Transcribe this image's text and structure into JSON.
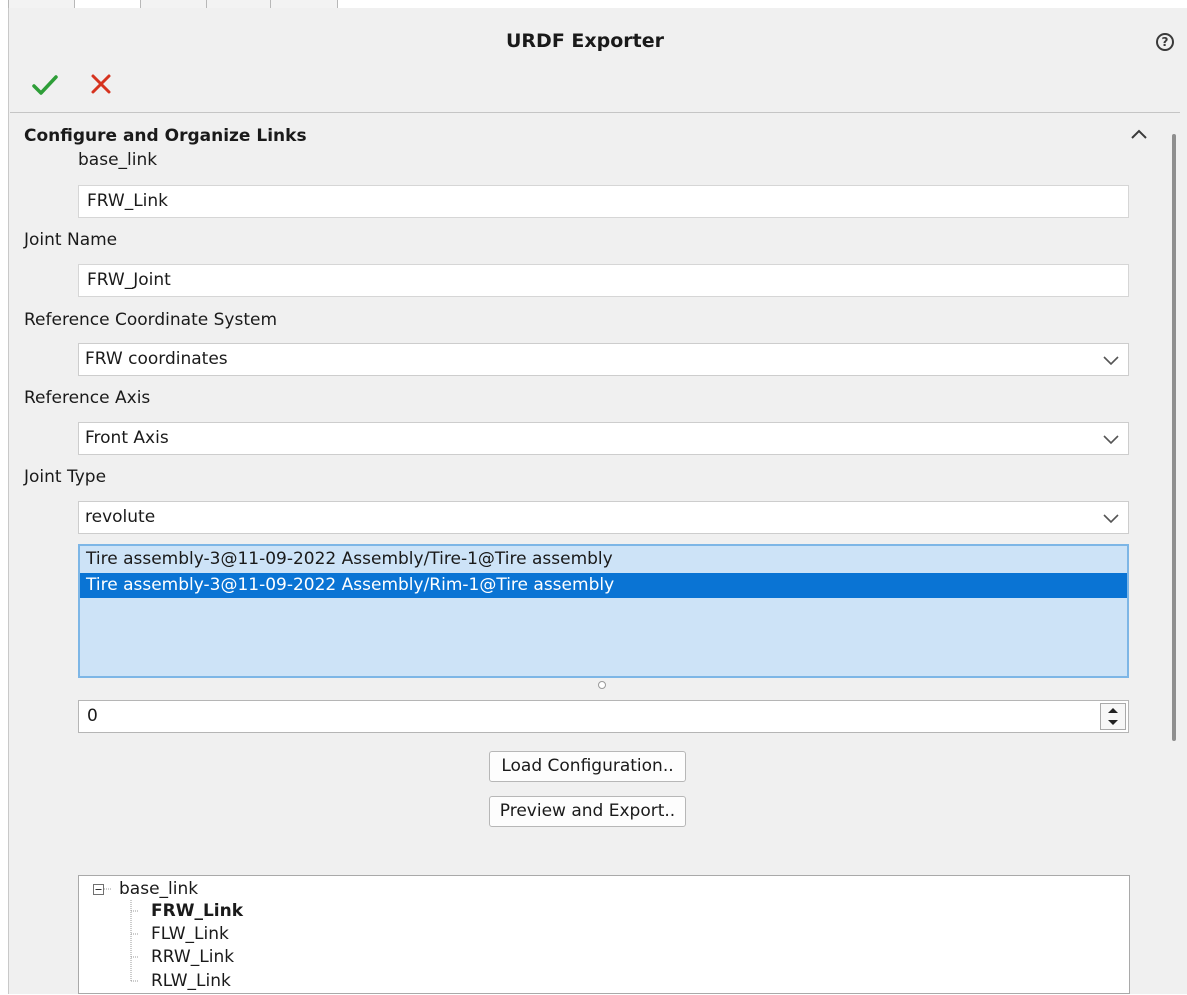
{
  "window": {
    "title": "URDF Exporter"
  },
  "header": {
    "help_icon": "help-icon",
    "ok_icon": "checkmark-icon",
    "cancel_icon": "close-icon",
    "colors": {
      "ok": "#2e9e38",
      "cancel": "#d6331f"
    }
  },
  "section": {
    "title": "Configure and Organize Links",
    "collapse_icon": "chevron-up-icon"
  },
  "form": {
    "link_label": "base_link",
    "link_name_value": "FRW_Link",
    "joint_name_label": "Joint Name",
    "joint_name_value": "FRW_Joint",
    "ref_coord_label": "Reference Coordinate System",
    "ref_coord_value": "FRW coordinates",
    "ref_axis_label": "Reference Axis",
    "ref_axis_value": "Front Axis",
    "joint_type_label": "Joint Type",
    "joint_type_value": "revolute"
  },
  "components": {
    "items": [
      {
        "label": "Tire assembly-3@11-09-2022 Assembly/Tire-1@Tire assembly",
        "selected": false
      },
      {
        "label": "Tire assembly-3@11-09-2022 Assembly/Rim-1@Tire assembly",
        "selected": true
      }
    ],
    "selection_color": "#0a74d4",
    "background_color": "#cde3f7"
  },
  "spinner": {
    "value": "0"
  },
  "buttons": {
    "load_config": "Load Configuration..",
    "preview_export": "Preview and Export.."
  },
  "tree": {
    "root": "base_link",
    "children": [
      {
        "label": "FRW_Link",
        "bold": true
      },
      {
        "label": "FLW_Link",
        "bold": false
      },
      {
        "label": "RRW_Link",
        "bold": false
      },
      {
        "label": "RLW_Link",
        "bold": false
      }
    ]
  }
}
